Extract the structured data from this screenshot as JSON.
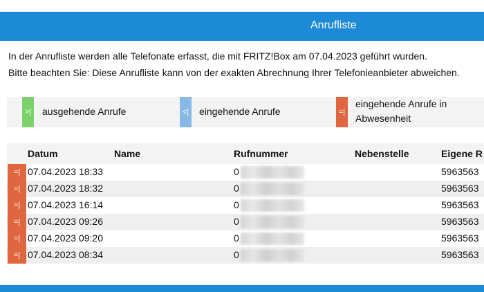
{
  "header": {
    "title": "Anrufliste"
  },
  "intro": {
    "line1": "In der Anrufliste werden alle Telefonate erfasst, die mit FRITZ!Box am 07.04.2023 geführt wurden.",
    "line2": "Bitte beachten Sie: Diese Anrufliste kann von der exakten Abrechnung Ihrer Telefonieanbieter abweichen."
  },
  "legend": {
    "outgoing": {
      "icon": ">|",
      "label": "ausgehende Anrufe"
    },
    "incoming": {
      "icon": "<|",
      "label": "eingehende Anrufe"
    },
    "missed": {
      "icon": "=|",
      "label_line1": "eingehende Anrufe in",
      "label_line2": "Abwesenheit"
    }
  },
  "table": {
    "columns": {
      "date": "Datum",
      "name": "Name",
      "number": "Rufnummer",
      "extension": "Nebenstelle",
      "own_number": "Eigene R"
    },
    "row_icon": "=|",
    "rows": [
      {
        "date": "07.04.2023 18:33",
        "number": "0",
        "own": "5963563"
      },
      {
        "date": "07.04.2023 18:32",
        "number": "0",
        "own": "5963563"
      },
      {
        "date": "07.04.2023 16:14",
        "number": "0",
        "own": "5963563"
      },
      {
        "date": "07.04.2023 09:26",
        "number": "0",
        "own": "5963563"
      },
      {
        "date": "07.04.2023 09:20",
        "number": "0",
        "own": "5963563"
      },
      {
        "date": "07.04.2023 08:34",
        "number": "0",
        "own": "5963563"
      }
    ]
  },
  "colors": {
    "brand_blue": "#1d8ad8",
    "outgoing_green": "#7cd26a",
    "incoming_blue": "#88b9e6",
    "missed_red": "#e0663f"
  }
}
